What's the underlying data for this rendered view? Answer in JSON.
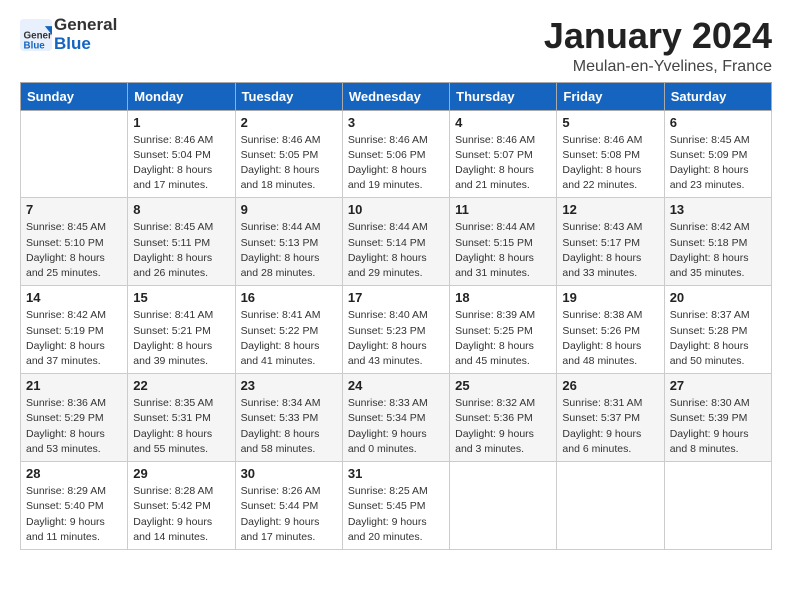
{
  "header": {
    "logo_general": "General",
    "logo_blue": "Blue",
    "month_title": "January 2024",
    "location": "Meulan-en-Yvelines, France"
  },
  "days_of_week": [
    "Sunday",
    "Monday",
    "Tuesday",
    "Wednesday",
    "Thursday",
    "Friday",
    "Saturday"
  ],
  "weeks": [
    [
      {
        "day": "",
        "info": ""
      },
      {
        "day": "1",
        "info": "Sunrise: 8:46 AM\nSunset: 5:04 PM\nDaylight: 8 hours\nand 17 minutes."
      },
      {
        "day": "2",
        "info": "Sunrise: 8:46 AM\nSunset: 5:05 PM\nDaylight: 8 hours\nand 18 minutes."
      },
      {
        "day": "3",
        "info": "Sunrise: 8:46 AM\nSunset: 5:06 PM\nDaylight: 8 hours\nand 19 minutes."
      },
      {
        "day": "4",
        "info": "Sunrise: 8:46 AM\nSunset: 5:07 PM\nDaylight: 8 hours\nand 21 minutes."
      },
      {
        "day": "5",
        "info": "Sunrise: 8:46 AM\nSunset: 5:08 PM\nDaylight: 8 hours\nand 22 minutes."
      },
      {
        "day": "6",
        "info": "Sunrise: 8:45 AM\nSunset: 5:09 PM\nDaylight: 8 hours\nand 23 minutes."
      }
    ],
    [
      {
        "day": "7",
        "info": "Sunrise: 8:45 AM\nSunset: 5:10 PM\nDaylight: 8 hours\nand 25 minutes."
      },
      {
        "day": "8",
        "info": "Sunrise: 8:45 AM\nSunset: 5:11 PM\nDaylight: 8 hours\nand 26 minutes."
      },
      {
        "day": "9",
        "info": "Sunrise: 8:44 AM\nSunset: 5:13 PM\nDaylight: 8 hours\nand 28 minutes."
      },
      {
        "day": "10",
        "info": "Sunrise: 8:44 AM\nSunset: 5:14 PM\nDaylight: 8 hours\nand 29 minutes."
      },
      {
        "day": "11",
        "info": "Sunrise: 8:44 AM\nSunset: 5:15 PM\nDaylight: 8 hours\nand 31 minutes."
      },
      {
        "day": "12",
        "info": "Sunrise: 8:43 AM\nSunset: 5:17 PM\nDaylight: 8 hours\nand 33 minutes."
      },
      {
        "day": "13",
        "info": "Sunrise: 8:42 AM\nSunset: 5:18 PM\nDaylight: 8 hours\nand 35 minutes."
      }
    ],
    [
      {
        "day": "14",
        "info": "Sunrise: 8:42 AM\nSunset: 5:19 PM\nDaylight: 8 hours\nand 37 minutes."
      },
      {
        "day": "15",
        "info": "Sunrise: 8:41 AM\nSunset: 5:21 PM\nDaylight: 8 hours\nand 39 minutes."
      },
      {
        "day": "16",
        "info": "Sunrise: 8:41 AM\nSunset: 5:22 PM\nDaylight: 8 hours\nand 41 minutes."
      },
      {
        "day": "17",
        "info": "Sunrise: 8:40 AM\nSunset: 5:23 PM\nDaylight: 8 hours\nand 43 minutes."
      },
      {
        "day": "18",
        "info": "Sunrise: 8:39 AM\nSunset: 5:25 PM\nDaylight: 8 hours\nand 45 minutes."
      },
      {
        "day": "19",
        "info": "Sunrise: 8:38 AM\nSunset: 5:26 PM\nDaylight: 8 hours\nand 48 minutes."
      },
      {
        "day": "20",
        "info": "Sunrise: 8:37 AM\nSunset: 5:28 PM\nDaylight: 8 hours\nand 50 minutes."
      }
    ],
    [
      {
        "day": "21",
        "info": "Sunrise: 8:36 AM\nSunset: 5:29 PM\nDaylight: 8 hours\nand 53 minutes."
      },
      {
        "day": "22",
        "info": "Sunrise: 8:35 AM\nSunset: 5:31 PM\nDaylight: 8 hours\nand 55 minutes."
      },
      {
        "day": "23",
        "info": "Sunrise: 8:34 AM\nSunset: 5:33 PM\nDaylight: 8 hours\nand 58 minutes."
      },
      {
        "day": "24",
        "info": "Sunrise: 8:33 AM\nSunset: 5:34 PM\nDaylight: 9 hours\nand 0 minutes."
      },
      {
        "day": "25",
        "info": "Sunrise: 8:32 AM\nSunset: 5:36 PM\nDaylight: 9 hours\nand 3 minutes."
      },
      {
        "day": "26",
        "info": "Sunrise: 8:31 AM\nSunset: 5:37 PM\nDaylight: 9 hours\nand 6 minutes."
      },
      {
        "day": "27",
        "info": "Sunrise: 8:30 AM\nSunset: 5:39 PM\nDaylight: 9 hours\nand 8 minutes."
      }
    ],
    [
      {
        "day": "28",
        "info": "Sunrise: 8:29 AM\nSunset: 5:40 PM\nDaylight: 9 hours\nand 11 minutes."
      },
      {
        "day": "29",
        "info": "Sunrise: 8:28 AM\nSunset: 5:42 PM\nDaylight: 9 hours\nand 14 minutes."
      },
      {
        "day": "30",
        "info": "Sunrise: 8:26 AM\nSunset: 5:44 PM\nDaylight: 9 hours\nand 17 minutes."
      },
      {
        "day": "31",
        "info": "Sunrise: 8:25 AM\nSunset: 5:45 PM\nDaylight: 9 hours\nand 20 minutes."
      },
      {
        "day": "",
        "info": ""
      },
      {
        "day": "",
        "info": ""
      },
      {
        "day": "",
        "info": ""
      }
    ]
  ]
}
